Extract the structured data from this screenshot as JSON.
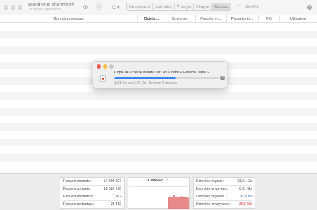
{
  "window": {
    "title": "Moniteur d'activité",
    "subtitle": "Toutes les opérations"
  },
  "toolbar": {
    "tabs": [
      {
        "label": "Processeur"
      },
      {
        "label": "Mémoire"
      },
      {
        "label": "Énergie"
      },
      {
        "label": "Disque"
      },
      {
        "label": "Réseau",
        "selected": true
      }
    ],
    "search_value": "chrome"
  },
  "columns": [
    {
      "label": "Nom du processus"
    },
    {
      "label": "Octets ..."
    },
    {
      "label": "Octets re..."
    },
    {
      "label": "Paquets en..."
    },
    {
      "label": "Paquets reç..."
    },
    {
      "label": "PID"
    },
    {
      "label": "Utilisateur"
    }
  ],
  "copy_dialog": {
    "title": "Copie de « Seule.la.terre.est...kv » dans « External Drive »",
    "status": "3,61 Go sur 6,09 Go - Environ 2 minutes",
    "progress_fraction": 0.59
  },
  "stats": {
    "packets": [
      {
        "label": "Paquets entrants :",
        "value": "57 806 027"
      },
      {
        "label": "Paquets sortants :",
        "value": "18 680 178"
      },
      {
        "label": "Paquets entrants/s :",
        "value": "682"
      },
      {
        "label": "Paquets sortants/s :",
        "value": "25 312"
      }
    ],
    "graph_title": "DONNÉES",
    "data": [
      {
        "label": "Données reçues :",
        "value": "68,51 Go",
        "tone": ""
      },
      {
        "label": "Données envoyées :",
        "value": "8,01 Go",
        "tone": ""
      },
      {
        "label": "Données reçues/s :",
        "value": "47,5 ko",
        "tone": "blue"
      },
      {
        "label": "Données envoyées/s :",
        "value": "36,5 Mo",
        "tone": "red"
      }
    ]
  },
  "colors": {
    "accent": "#3b82f0",
    "close": "#ec5f57",
    "minimize": "#f4bd4f",
    "zoom": "#c8c8c8",
    "sent": "#e7898a",
    "received": "#3b6fd8"
  }
}
